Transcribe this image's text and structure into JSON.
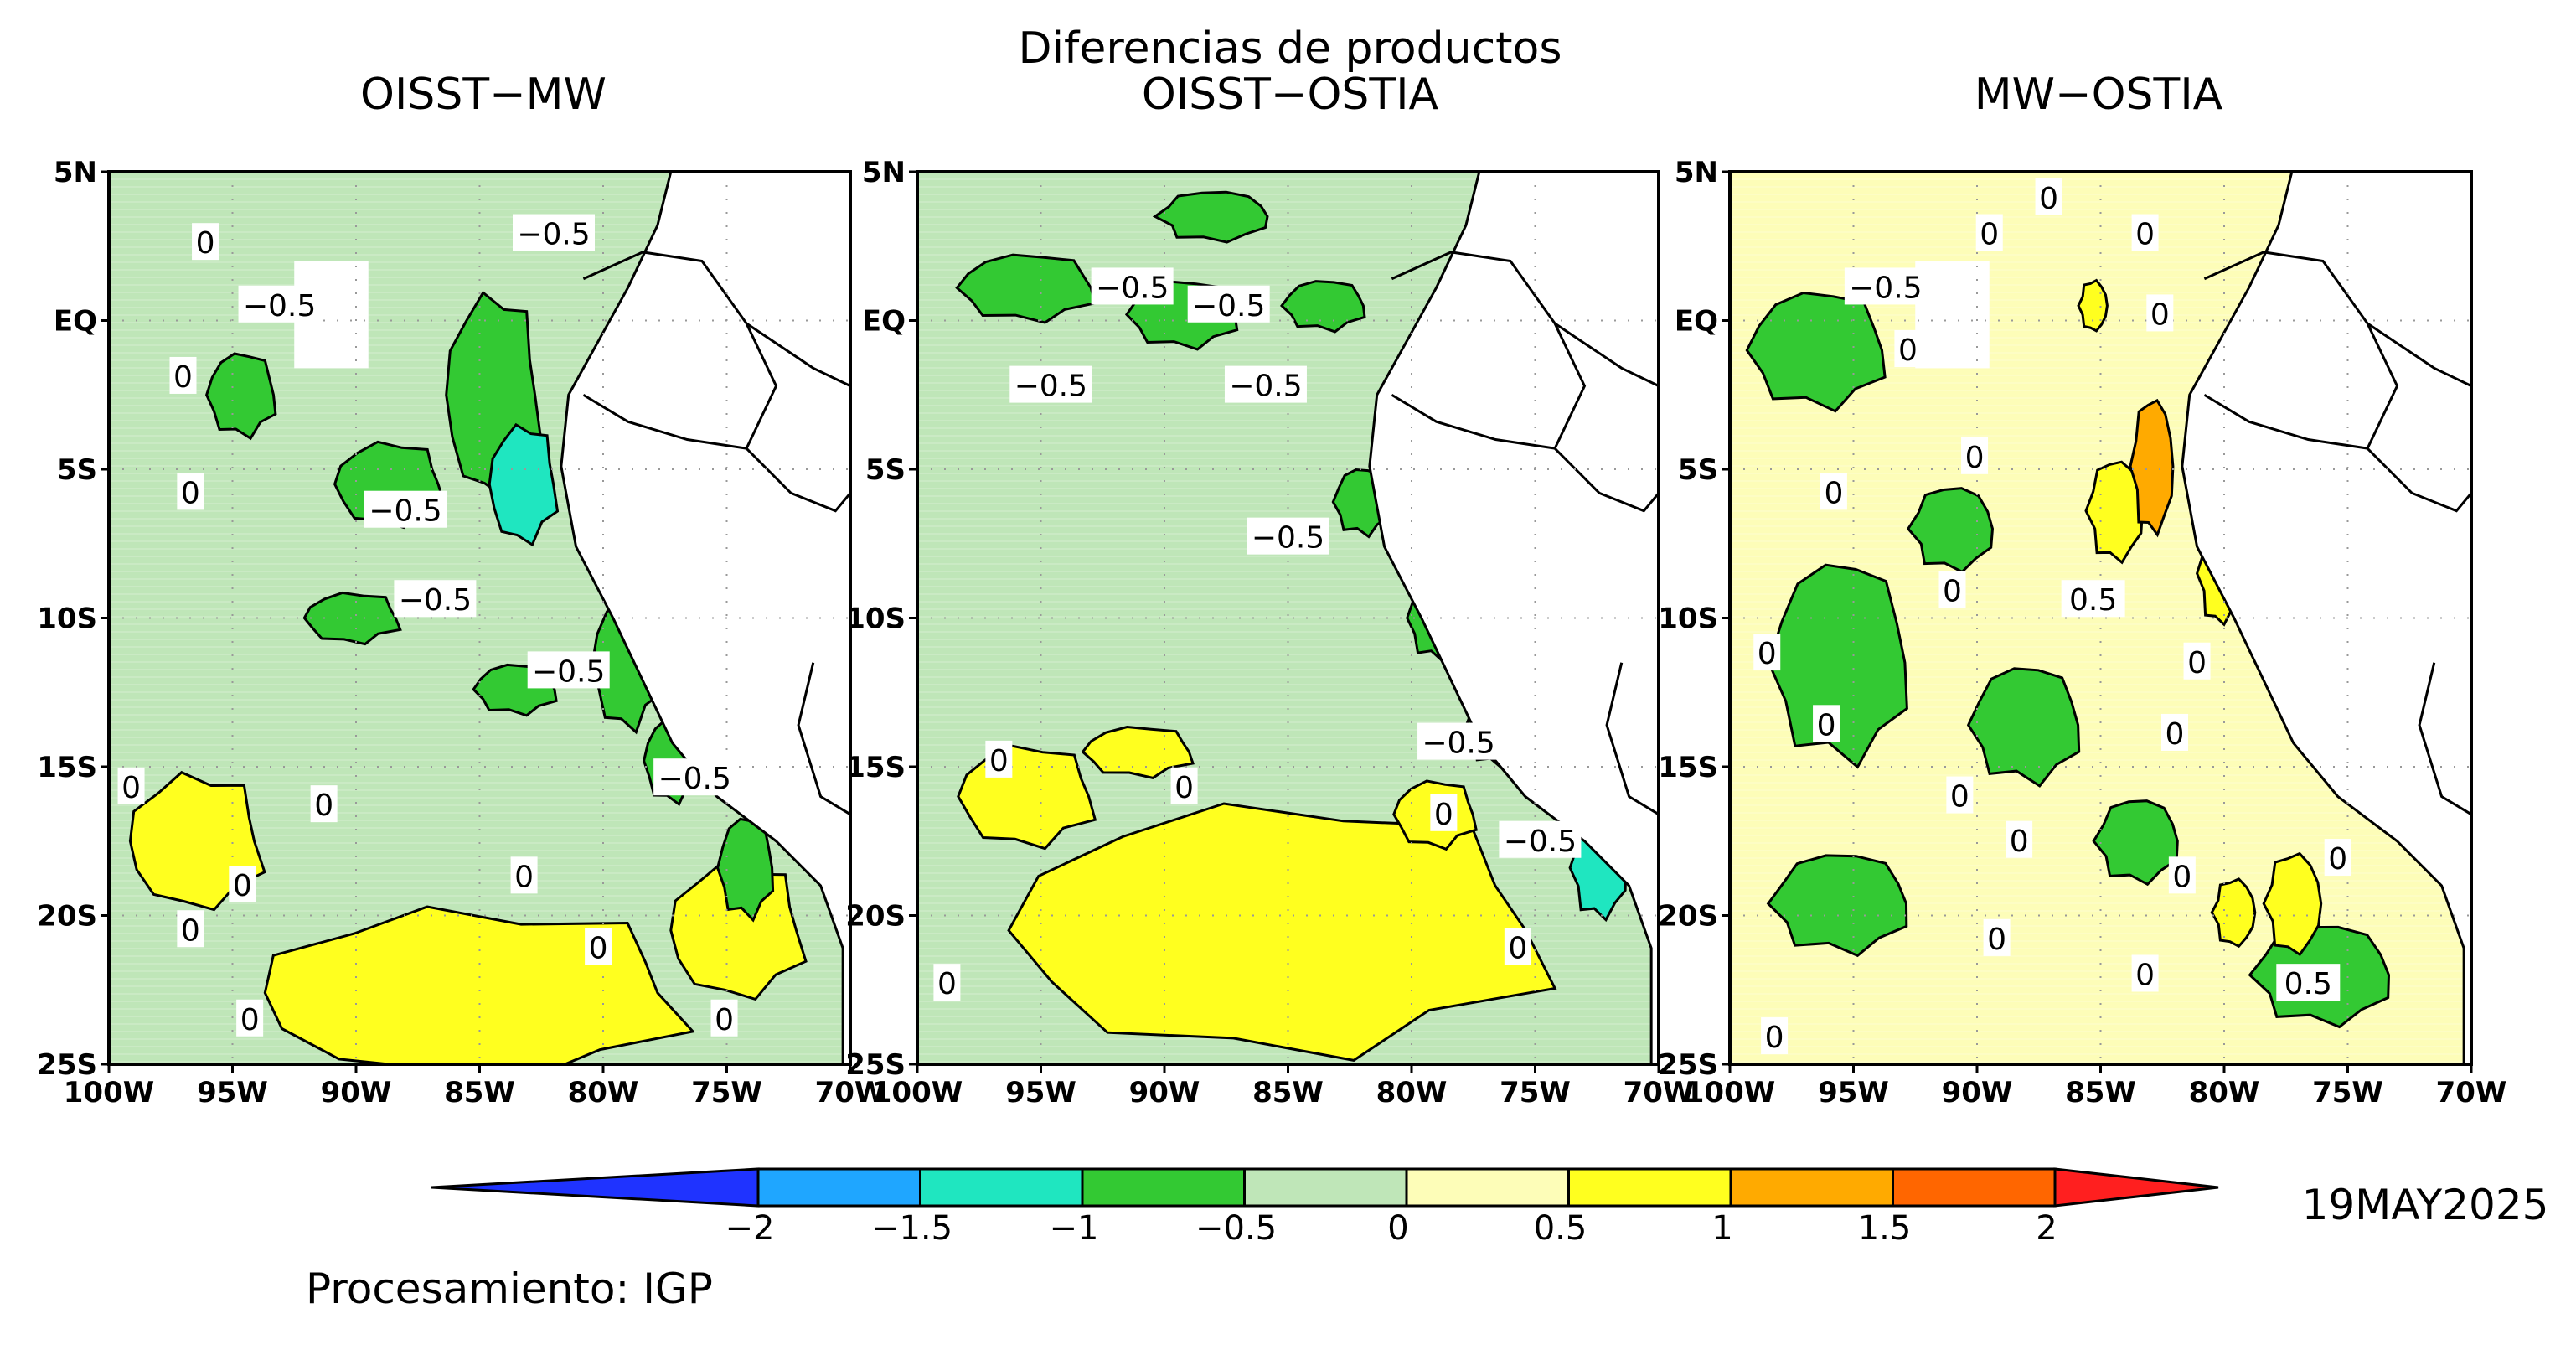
{
  "figure": {
    "supertitle": "Diferencias de productos",
    "date": "19MAY2025",
    "credit": "Procesamiento: IGP"
  },
  "panels": [
    {
      "title": "OISST−MW",
      "base_color": "#bfe6b8",
      "contour_labels": [
        "0",
        "−0.5",
        "−0.5",
        "0",
        "0",
        "−0.5",
        "−0.5",
        "−0.5",
        "−0.5",
        "0",
        "0",
        "0",
        "0",
        "0",
        "0",
        "0",
        "0"
      ],
      "green_patches": 9,
      "yellow_patches": 3
    },
    {
      "title": "OISST−OSTIA",
      "base_color": "#bfe6b8",
      "contour_labels": [
        "−0.5",
        "−0.5",
        "−0.5",
        "−0.5",
        "−0.5",
        "0",
        "0",
        "−0.5",
        "0",
        "−0.5",
        "0",
        "0"
      ],
      "green_patches": 8,
      "yellow_patches": 4
    },
    {
      "title": "MW−OSTIA",
      "base_color": "#fdfdb8",
      "contour_labels": [
        "0",
        "0",
        "0",
        "0",
        "−0.5",
        "0",
        "0",
        "0",
        "0",
        "0",
        "0.5",
        "0",
        "0",
        "0",
        "0",
        "0",
        "0",
        "0",
        "0",
        "0",
        "0.5",
        "0"
      ],
      "green_patches": 7,
      "yellow_patches": 6
    }
  ],
  "axes": {
    "x_ticks": [
      "100W",
      "95W",
      "90W",
      "85W",
      "80W",
      "75W",
      "70W"
    ],
    "y_ticks": [
      "5N",
      "EQ",
      "5S",
      "10S",
      "15S",
      "20S",
      "25S"
    ]
  },
  "colorbar": {
    "colors": [
      "#1f33ff",
      "#1fa6ff",
      "#1fe6c0",
      "#33c933",
      "#bfe6b8",
      "#fdfdb8",
      "#ffff1f",
      "#ffaa00",
      "#ff6600",
      "#ff1f1f"
    ],
    "labels": [
      "−2",
      "−1.5",
      "−1",
      "−0.5",
      "0",
      "0.5",
      "1",
      "1.5",
      "2"
    ]
  }
}
